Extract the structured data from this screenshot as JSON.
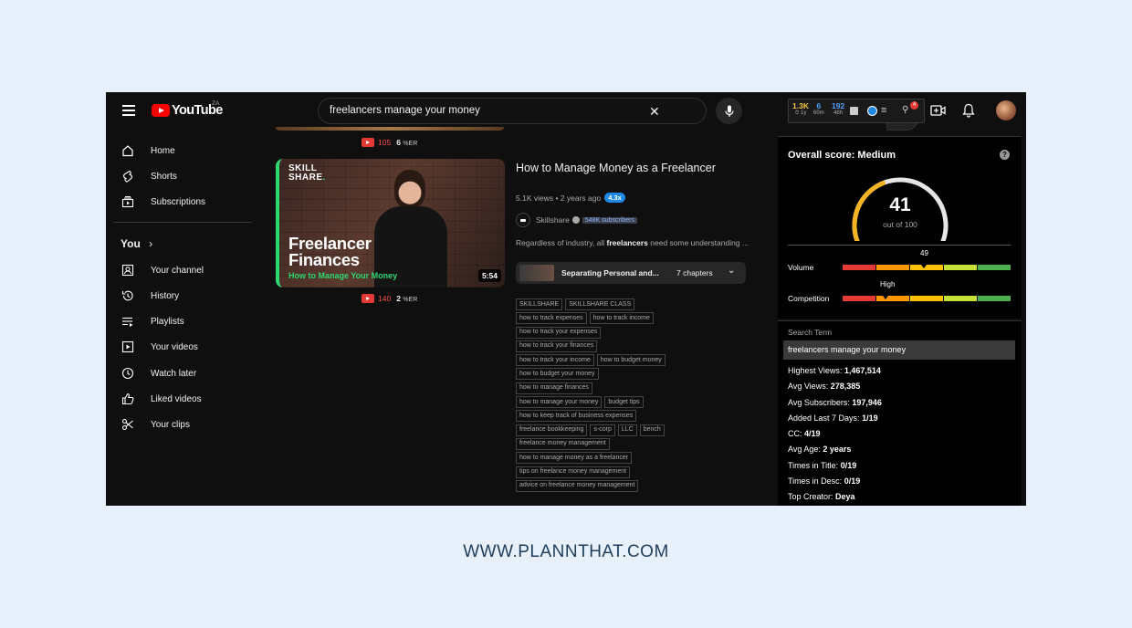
{
  "topbar": {
    "logo_text": "YouTube",
    "country": "ZA",
    "search_value": "freelancers manage your money",
    "ext_stats": [
      {
        "value": "1.3K",
        "sub": "1y",
        "color": "#f5c542"
      },
      {
        "value": "6",
        "sub": "60m",
        "color": "#4fa3ff"
      },
      {
        "value": "192",
        "sub": "48h",
        "color": "#4fa3ff"
      }
    ],
    "notification_count": "4"
  },
  "sidebar": {
    "main_items": [
      {
        "label": "Home",
        "icon": "home-icon"
      },
      {
        "label": "Shorts",
        "icon": "shorts-icon"
      },
      {
        "label": "Subscriptions",
        "icon": "subscriptions-icon"
      }
    ],
    "you_title": "You",
    "you_items": [
      {
        "label": "Your channel",
        "icon": "channel-icon"
      },
      {
        "label": "History",
        "icon": "history-icon"
      },
      {
        "label": "Playlists",
        "icon": "playlists-icon"
      },
      {
        "label": "Your videos",
        "icon": "videos-icon"
      },
      {
        "label": "Watch later",
        "icon": "clock-icon"
      },
      {
        "label": "Liked videos",
        "icon": "like-icon"
      },
      {
        "label": "Your clips",
        "icon": "scissors-icon"
      }
    ]
  },
  "prev_result": {
    "stat_red": "105",
    "stat_er": "6",
    "er_unit": "%ER"
  },
  "video": {
    "thumb_brand_line1": "SKILL",
    "thumb_brand_line2": "SHARE",
    "thumb_title_line1": "Freelancer",
    "thumb_title_line2": "Finances",
    "thumb_subtitle": "How to Manage Your Money",
    "duration": "5:54",
    "stat_red": "140",
    "stat_er": "2",
    "er_unit": "%ER",
    "title": "How to Manage Money as a Freelancer",
    "meta": "5.1K views • 2 years ago",
    "multiplier": "4.3x",
    "channel": "Skillshare",
    "subscribers": "548K subscribers",
    "desc_prefix": "Regardless of industry, all ",
    "desc_bold": "freelancers",
    "desc_suffix": " need some understanding ...",
    "chapter_title": "Separating Personal and...",
    "chapter_count": "7 chapters",
    "tags": [
      [
        "SKILLSHARE",
        "SKILLSHARE CLASS"
      ],
      [
        "how to track expenses",
        "how to track income"
      ],
      [
        "how to track your expenses"
      ],
      [
        "how to track your finances"
      ],
      [
        "how to track your income",
        "how to budget money"
      ],
      [
        "how to budget your money"
      ],
      [
        "how to manage finances"
      ],
      [
        "how to manage your money",
        "budget tips"
      ],
      [
        "how to keep track of business expenses"
      ],
      [
        "freelance bookkeeping",
        "s-corp",
        "LLC",
        "bench"
      ],
      [
        "freelance money management"
      ],
      [
        "how to manage money as a freelancer"
      ],
      [
        "tips on freelance money management"
      ],
      [
        "advice on freelance money management"
      ]
    ]
  },
  "panel": {
    "title": "Overall score: Medium",
    "help": "?",
    "score": "41",
    "score_sub": "out of 100",
    "score_value": 41,
    "volume_label": "Volume",
    "volume_value": "49",
    "competition_label": "Competition",
    "competition_value": "High",
    "bar_colors": [
      "#e53935",
      "#ff9800",
      "#ffc107",
      "#c6e03a",
      "#4caf50"
    ]
  },
  "search_term": {
    "label": "Search Term",
    "value": "freelancers manage your money",
    "rows": [
      {
        "k": "Highest Views:",
        "v": "1,467,514"
      },
      {
        "k": "Avg Views:",
        "v": "278,385"
      },
      {
        "k": "Avg Subscribers:",
        "v": "197,946"
      },
      {
        "k": "Added Last 7 Days:",
        "v": "1/19"
      },
      {
        "k": "CC:",
        "v": "4/19"
      },
      {
        "k": "Avg Age:",
        "v": "2 years"
      },
      {
        "k": "Times in Title:",
        "v": "0/19"
      },
      {
        "k": "Times in Desc:",
        "v": "0/19"
      },
      {
        "k": "Top Creator:",
        "v": "Deya"
      }
    ]
  },
  "footer": {
    "url": "WWW.PLANNTHAT.COM"
  }
}
